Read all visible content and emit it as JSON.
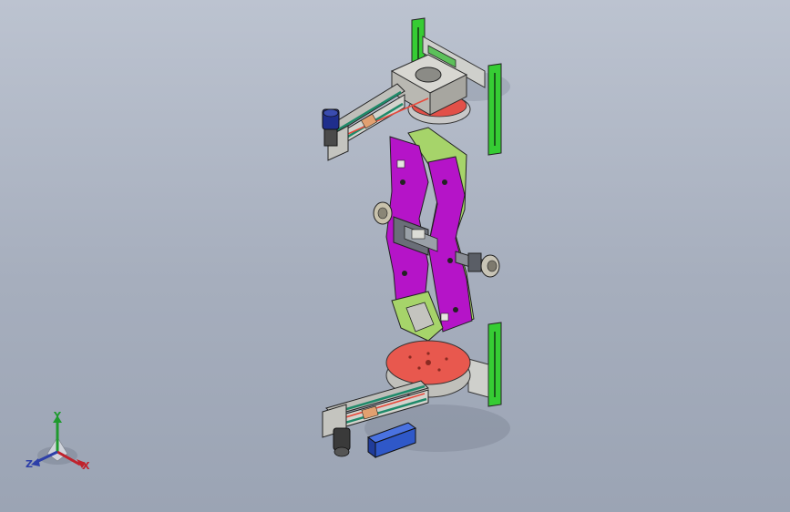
{
  "viewport": {
    "background_top": "#bcc3d0",
    "background_bottom": "#9ba4b4"
  },
  "model": {
    "colors": {
      "frame_green": "#2ecc2e",
      "arm_magenta": "#b514c8",
      "bracket_lime": "#a6d46a",
      "turntable_red": "#e8584e",
      "carriage_gray": "#c9c9c4",
      "rail_teal": "#1f8a6a",
      "motor_navy": "#1f2e8c",
      "box_blue": "#2f58c8"
    }
  },
  "triad": {
    "x_label": "X",
    "y_label": "Y",
    "z_label": "Z",
    "x_color": "#c0222c",
    "y_color": "#1f9a2e",
    "z_color": "#2d3fa8"
  }
}
